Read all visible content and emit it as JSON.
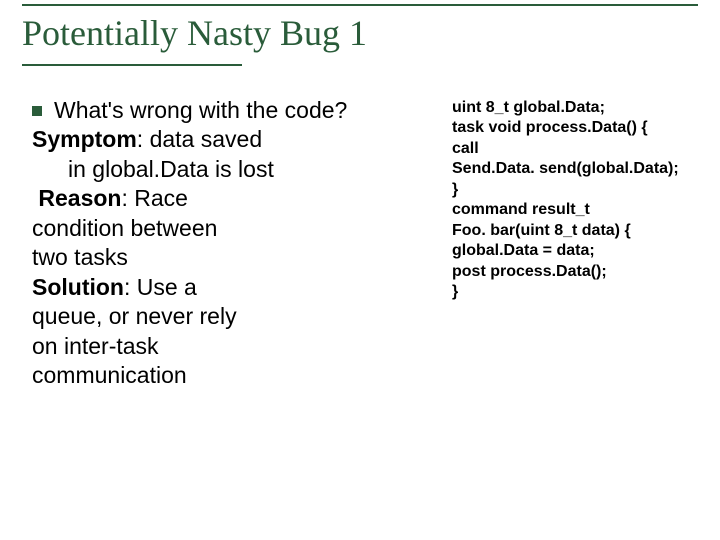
{
  "title": "Potentially Nasty Bug 1",
  "body": {
    "question": "What's wrong with  the code?",
    "symptom_label": "Symptom",
    "symptom_l1": ": data saved",
    "symptom_l2": "in global.Data is lost",
    "reason_label": "Reason",
    "reason_l1": ": Race",
    "reason_l2": "condition between",
    "reason_l3": "two tasks",
    "solution_label": "Solution",
    "solution_l1": ": Use a",
    "solution_l2": "queue, or never rely",
    "solution_l3": "on inter-task",
    "solution_l4": "communication"
  },
  "code": {
    "l1": "uint 8_t global.Data;",
    "l2": "task void process.Data() {",
    "l3": "call",
    "l4": "Send.Data. send(global.Data);",
    "l5": "}",
    "l6": "command result_t",
    "l7": "Foo. bar(uint 8_t data) {",
    "l8": "global.Data = data;",
    "l9": "post process.Data();",
    "l10": "}"
  }
}
